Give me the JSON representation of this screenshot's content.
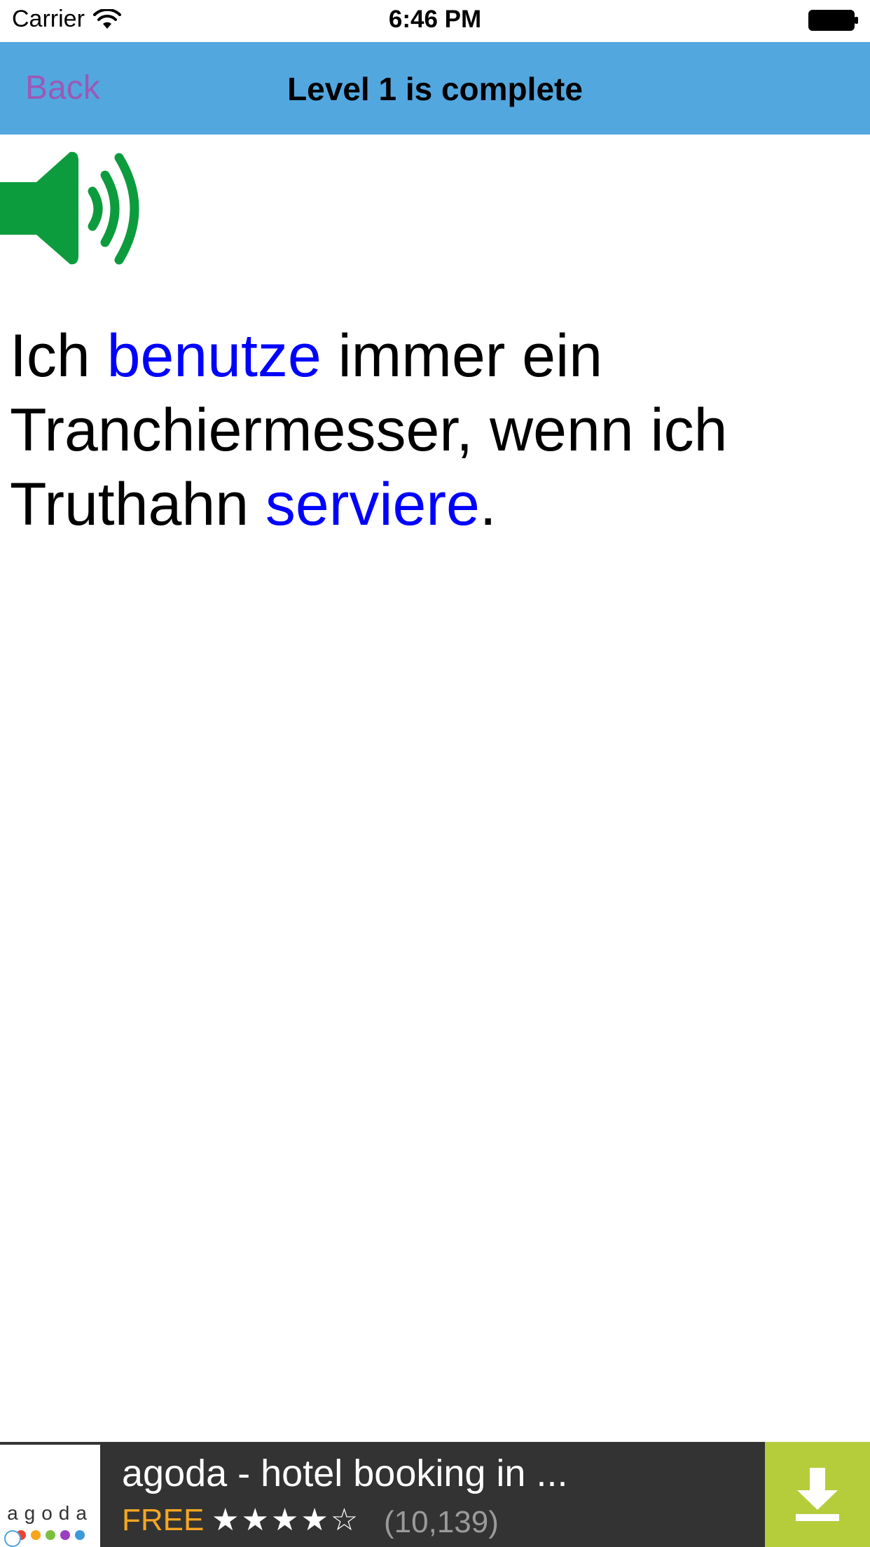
{
  "status_bar": {
    "carrier": "Carrier",
    "time": "6:46 PM"
  },
  "nav": {
    "back_label": "Back",
    "title": "Level 1 is complete"
  },
  "sentence": {
    "parts": [
      {
        "text": "Ich ",
        "highlight": false
      },
      {
        "text": "benutze",
        "highlight": true
      },
      {
        "text": " immer ein Tranchiermesser, wenn ich Truthahn ",
        "highlight": false
      },
      {
        "text": "serviere",
        "highlight": true
      },
      {
        "text": ".",
        "highlight": false
      }
    ]
  },
  "colors": {
    "nav_background": "#53a7df",
    "back_text": "#9b59b6",
    "highlight": "#0000ff",
    "speaker": "#0d9c3d",
    "ad_background": "#333333",
    "ad_price": "#f5a623",
    "ad_download": "#b5cd3b"
  },
  "icons": {
    "wifi": "wifi-icon",
    "battery": "battery-icon",
    "speaker": "speaker-icon",
    "download": "download-icon",
    "ad_info": "info-icon"
  },
  "ad": {
    "logo_text": "agoda",
    "title": "agoda - hotel booking in ...",
    "price": "FREE",
    "stars": "★★★★☆",
    "rating_value": 4.5,
    "rating_count": "(10,139)"
  }
}
